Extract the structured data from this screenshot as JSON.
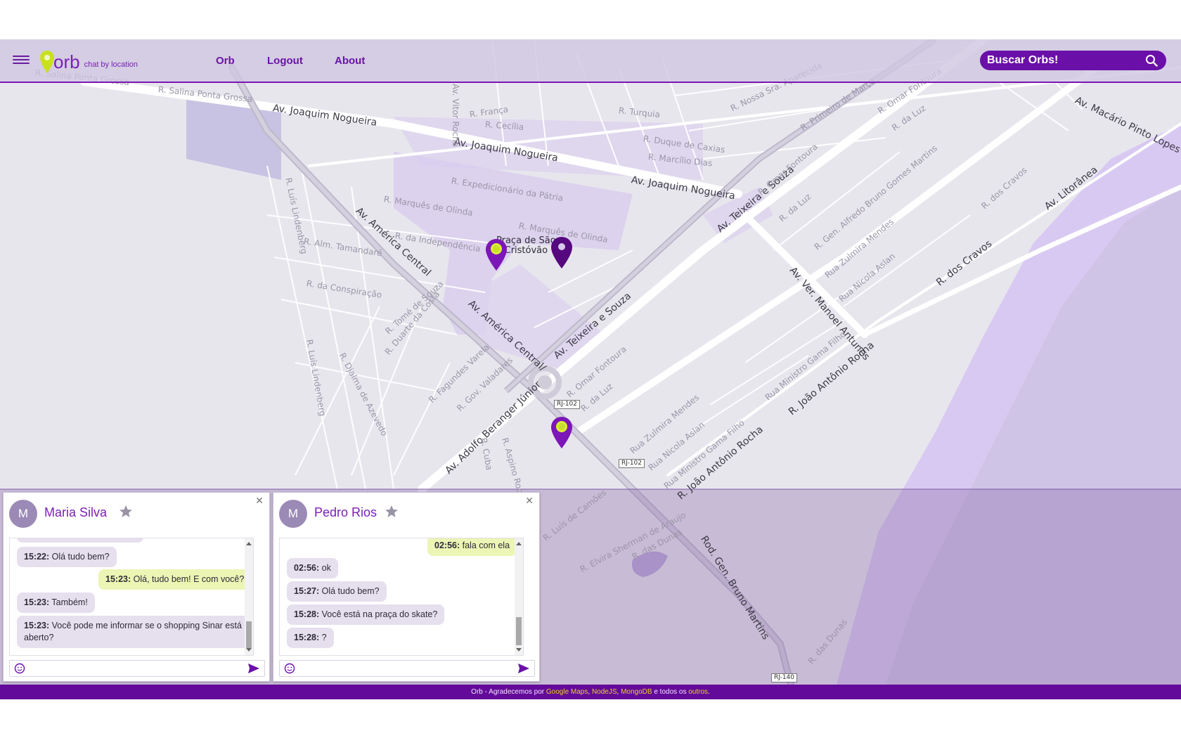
{
  "header": {
    "brand": "orb",
    "tagline": "chat by location",
    "nav": [
      "Orb",
      "Logout",
      "About"
    ],
    "search_placeholder": "Buscar Orbs!"
  },
  "colors": {
    "accent": "#6a0fa8",
    "header_bg": "#cec5e0",
    "footer_bg": "#640a9a",
    "bubble_mine": "#ecf5b4",
    "bubble_theirs": "#e6dfee",
    "pin_lime": "#d9ee35"
  },
  "map": {
    "streets": [
      "R. Salina Ponta Grossa",
      "Av. Joaquim Nogueira",
      "Av. Joaquim Nogueira",
      "Av. Joaquim Nogueira",
      "Av. Vitor Rocha",
      "R. França",
      "R. Cecília",
      "R. Turquia",
      "R. Duque de Caxias",
      "R. Marcílio Dias",
      "R. Nossa Sra. Aparecida",
      "R. Primeiro de Março",
      "R. Omar Fontoura",
      "R. da Luz",
      "Av. Macário Pinto Lopes",
      "R. Expedicionário da Pátria",
      "R. Marquês de Olinda",
      "R. Marquês de Olinda",
      "R. da Independência",
      "R. Alm. Tamandaré",
      "R. Luís Lindenberg",
      "Av. América Central",
      "R. da Conspiração",
      "R. Tomé de Souza",
      "R. Duarte da Costa",
      "Av. América Central/",
      "Av. Teixeira e Souza",
      "Av. Teixeira e Souza",
      "R. Omar Fontoura",
      "R. da Luz",
      "R. Gen. Alfredo Bruno Gomes Martins",
      "Rua Zulmira Mendes",
      "Rua Nicola Aslan",
      "Av. Ver. Manoel Antunes",
      "R. dos Cravos",
      "R. dos Cravos",
      "Av. Litorânea",
      "R. Luís Lindenberg",
      "R. Djalma de Azevedo",
      "R. Fagundes Varela",
      "R. Gov. Valadares",
      "R. Omar Fontoura",
      "R. da Luz",
      "Av. Adolfo Beranger Júnior",
      "R. Cuba",
      "R. Aspino Rocha",
      "Rua Zulmira Mendes",
      "Rua Nicola Aslan",
      "Rua Ministro Gama Filho",
      "Rua Ministro Gama Filho",
      "R. João Antônio Rocha",
      "R. João Antônio Rocha",
      "R. Luís de Camões",
      "R. Elvira Sherman de Araujo",
      "R. das Dunas",
      "Rod. Gen. Bruno Martins",
      "R. das Dunas"
    ],
    "poi": [
      "Praça de São",
      "Cristóvão"
    ],
    "badges": [
      "RJ-102",
      "RJ-102",
      "RJ-140"
    ]
  },
  "chats": [
    {
      "avatar": "M",
      "name": "Maria Silva",
      "messages": [
        {
          "time": "15:22:",
          "text": "Olá tudo bem?",
          "mine": false
        },
        {
          "time": "15:23:",
          "text": "Olá, tudo bem! E com você?",
          "mine": true
        },
        {
          "time": "15:23:",
          "text": "Também!",
          "mine": false
        },
        {
          "time": "15:23:",
          "text": "Você pode me informar se o shopping Sinar está",
          "text2": "aberto?",
          "mine": false
        }
      ]
    },
    {
      "avatar": "M",
      "name": "Pedro Rios",
      "messages": [
        {
          "time": "02:56:",
          "text": "fala com ela",
          "mine": true
        },
        {
          "time": "02:56:",
          "text": "ok",
          "mine": false
        },
        {
          "time": "15:27:",
          "text": "Olá tudo bem?",
          "mine": false
        },
        {
          "time": "15:28:",
          "text": "Você está na praça do skate?",
          "mine": false
        },
        {
          "time": "15:28:",
          "text": "?",
          "mine": false
        }
      ]
    }
  ],
  "footer": {
    "prefix": "Orb - Agradecemos por ",
    "link1": "Google Maps",
    "sep1": ", ",
    "link2": "NodeJS",
    "sep2": ", ",
    "link3": "MongoDB",
    "middle": " e todos os ",
    "link4": "outros",
    "suffix": "."
  }
}
